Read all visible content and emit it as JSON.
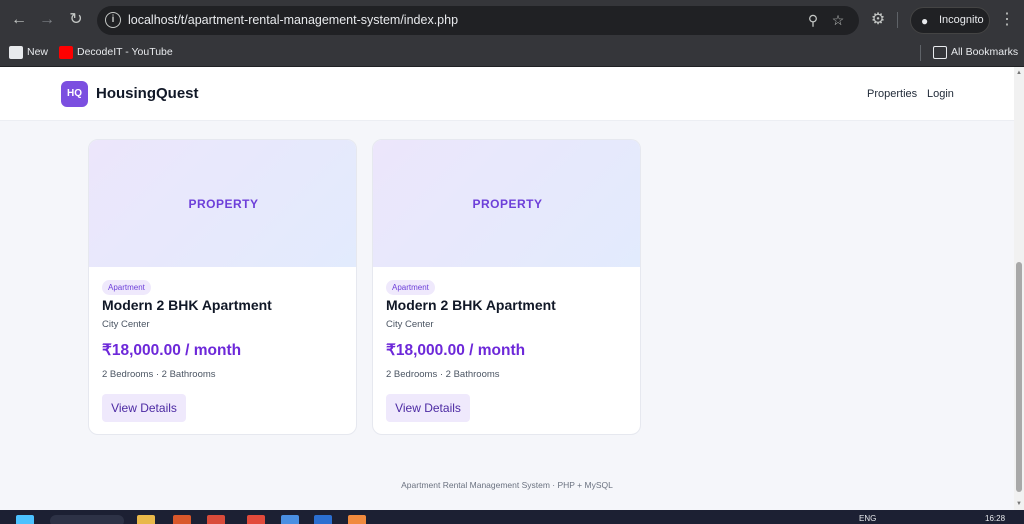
{
  "browser": {
    "url": "localhost/t/apartment-rental-management-system/index.php",
    "incognito_label": "Incognito",
    "bookmarks": [
      {
        "label": "New"
      },
      {
        "label": "DecodeIT - YouTube"
      }
    ],
    "all_bookmarks_label": "All Bookmarks"
  },
  "site": {
    "logo_text": "HQ",
    "brand": "HousingQuest",
    "nav": [
      "Properties",
      "Login"
    ],
    "accent_color": "#7b4fe0"
  },
  "cards": [
    {
      "hero_label": "PROPERTY",
      "tag": "Apartment",
      "title": "Modern 2 BHK Apartment",
      "location": "City Center",
      "price": "₹18,000.00 / month",
      "meta": "2 Bedrooms · 2 Bathrooms",
      "button": "View Details"
    },
    {
      "hero_label": "PROPERTY",
      "tag": "Apartment",
      "title": "Modern 2 BHK Apartment",
      "location": "City Center",
      "price": "₹18,000.00 / month",
      "meta": "2 Bedrooms · 2 Bathrooms",
      "button": "View Details"
    }
  ],
  "footer": "Apartment Rental Management System · PHP + MySQL",
  "taskbar": {
    "lang": "ENG",
    "time": "16:28"
  }
}
